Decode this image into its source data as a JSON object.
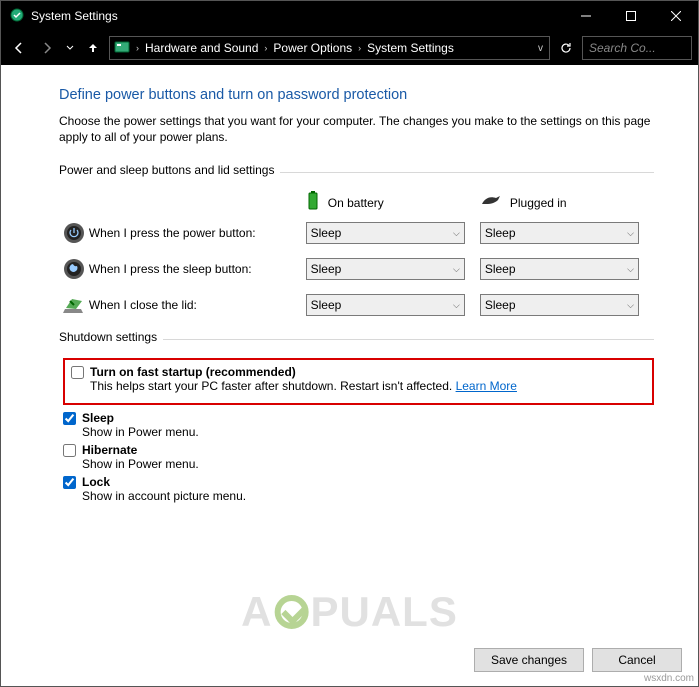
{
  "titlebar": {
    "title": "System Settings"
  },
  "nav": {
    "crumb1": "Hardware and Sound",
    "crumb2": "Power Options",
    "crumb3": "System Settings",
    "search_placeholder": "Search Co..."
  },
  "page": {
    "heading": "Define power buttons and turn on password protection",
    "description": "Choose the power settings that you want for your computer. The changes you make to the settings on this page apply to all of your power plans.",
    "group1_label": "Power and sleep buttons and lid settings",
    "col_battery": "On battery",
    "col_plugged": "Plugged in",
    "row1_label": "When I press the power button:",
    "row2_label": "When I press the sleep button:",
    "row3_label": "When I close the lid:",
    "row1_batt": "Sleep",
    "row1_plug": "Sleep",
    "row2_batt": "Sleep",
    "row2_plug": "Sleep",
    "row3_batt": "Sleep",
    "row3_plug": "Sleep",
    "group2_label": "Shutdown settings",
    "fast_label": "Turn on fast startup (recommended)",
    "fast_sub": "This helps start your PC faster after shutdown. Restart isn't affected. ",
    "fast_link": "Learn More",
    "sleep_label": "Sleep",
    "sleep_sub": "Show in Power menu.",
    "hib_label": "Hibernate",
    "hib_sub": "Show in Power menu.",
    "lock_label": "Lock",
    "lock_sub": "Show in account picture menu."
  },
  "footer": {
    "save": "Save changes",
    "cancel": "Cancel"
  },
  "watermark": {
    "pre": "A",
    "post": "PUALS",
    "src": "wsxdn.com"
  }
}
